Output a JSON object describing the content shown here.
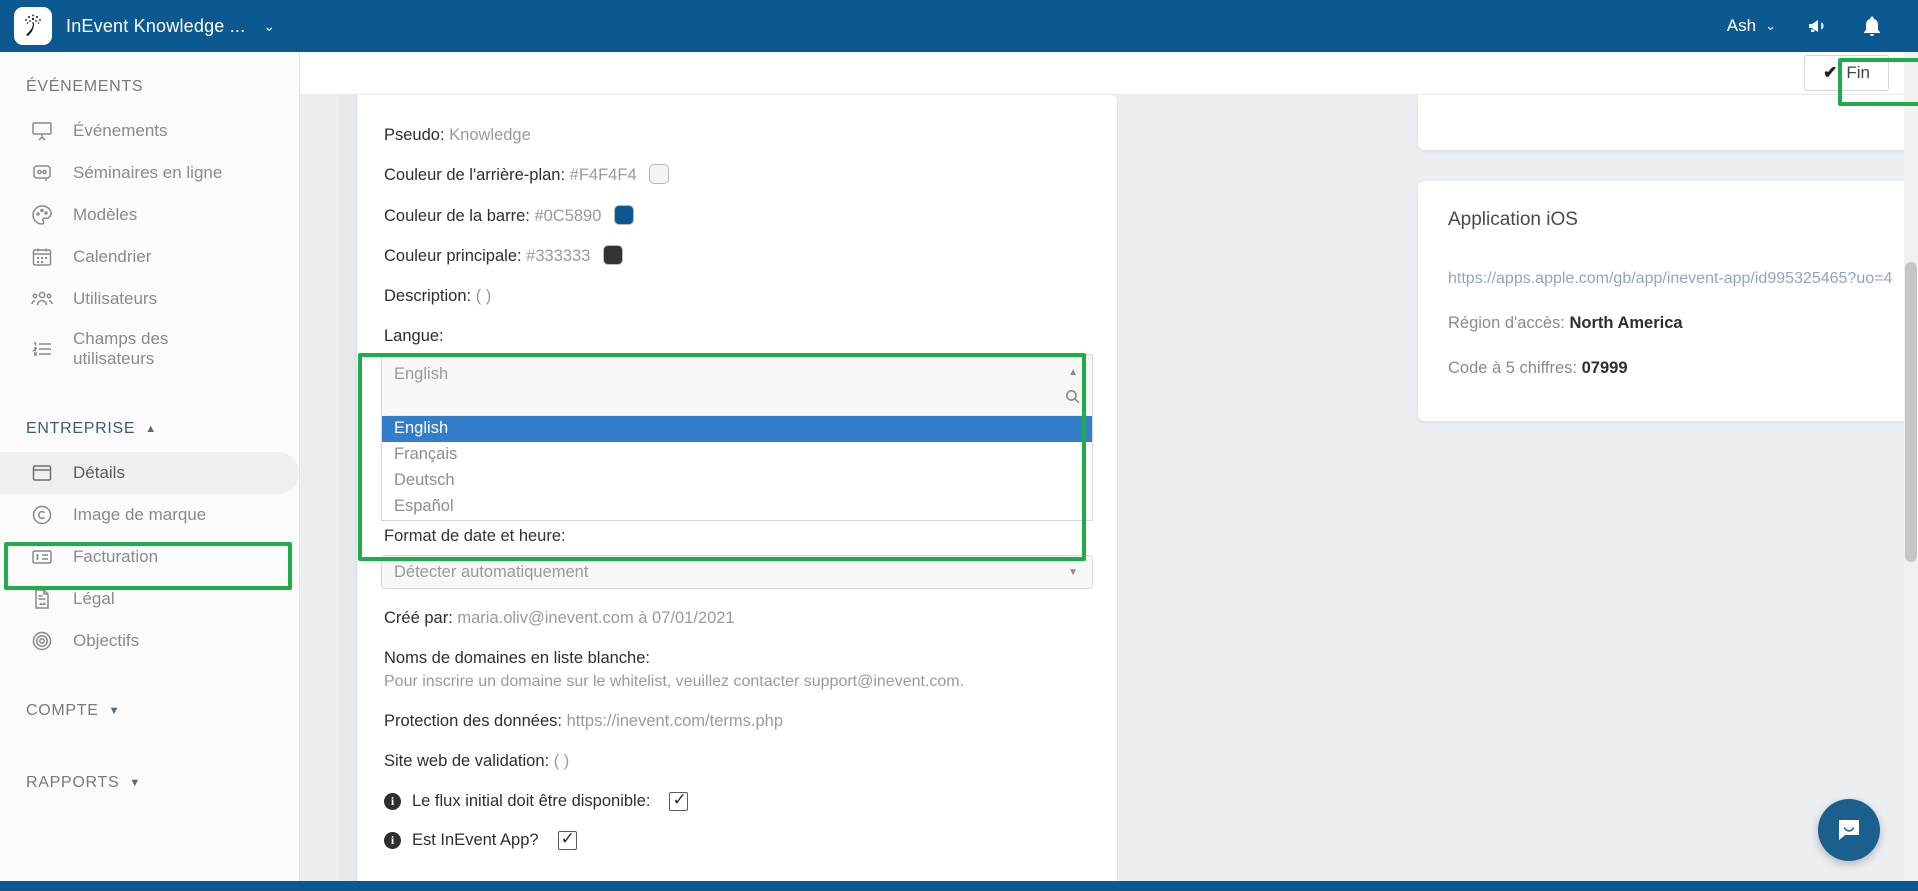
{
  "topbar": {
    "brand_title": "InEvent Knowledge ...",
    "brand_caret": "⌄",
    "user_name": "Ash",
    "user_caret": "⌄",
    "announcement_icon": "megaphone-icon",
    "notifications_icon": "bell-icon",
    "bar_color": "#0C5890"
  },
  "subheader": {
    "finish_label": "Fin",
    "finish_check": "✔"
  },
  "sidebar": {
    "events_section_title": "ÉVÉNEMENTS",
    "events_items": [
      {
        "label": "Événements",
        "icon": "presentation-screen-icon"
      },
      {
        "label": "Séminaires en ligne",
        "icon": "webinar-icon"
      },
      {
        "label": "Modèles",
        "icon": "palette-icon"
      },
      {
        "label": "Calendrier",
        "icon": "calendar-icon"
      },
      {
        "label": "Utilisateurs",
        "icon": "users-icon"
      },
      {
        "label": "Champs des utilisateurs",
        "icon": "list-numbered-icon"
      }
    ],
    "enterprise_section_title": "ENTREPRISE",
    "enterprise_chevron": "▲",
    "enterprise_items": [
      {
        "label": "Détails",
        "icon": "window-icon",
        "active": true
      },
      {
        "label": "Image de marque",
        "icon": "copyright-icon",
        "active": false
      },
      {
        "label": "Facturation",
        "icon": "billing-card-icon",
        "active": false
      },
      {
        "label": "Légal",
        "icon": "document-icon",
        "active": false
      },
      {
        "label": "Objectifs",
        "icon": "target-icon",
        "active": false
      }
    ],
    "account_section_title": "COMPTE",
    "account_chevron": "▼",
    "reports_section_title": "RAPPORTS",
    "reports_chevron": "▼"
  },
  "details_form": {
    "pseudo_label": "Pseudo:",
    "pseudo_value": "Knowledge",
    "bg_color_label": "Couleur de l'arrière-plan:",
    "bg_color_value": "#F4F4F4",
    "bg_color_hex": "#F4F4F4",
    "bar_color_label": "Couleur de la barre:",
    "bar_color_value": "#0C5890",
    "bar_color_hex": "#0C5890",
    "main_color_label": "Couleur principale:",
    "main_color_value": "#333333",
    "main_color_hex": "#333333",
    "description_label": "Description:",
    "description_value": "( )",
    "language_label": "Langue:",
    "language_selected": "English",
    "language_search_icon": "search-icon",
    "language_up_caret": "▲",
    "language_options": [
      {
        "label": "English",
        "selected": true
      },
      {
        "label": "Français",
        "selected": false
      },
      {
        "label": "Deutsch",
        "selected": false
      },
      {
        "label": "Español",
        "selected": false
      }
    ],
    "datetime_format_label": "Format de date et heure:",
    "datetime_format_value": "Détecter automatiquement",
    "datetime_caret": "▼",
    "created_by_label": "Créé par:",
    "created_by_value": "maria.oliv@inevent.com à 07/01/2021",
    "whitelist_label": "Noms de domaines en liste blanche:",
    "whitelist_note": "Pour inscrire un domaine sur le whitelist, veuillez contacter support@inevent.com.",
    "data_protection_label": "Protection des données:",
    "data_protection_value": "https://inevent.com/terms.php",
    "validation_site_label": "Site web de validation:",
    "validation_site_value": "( )",
    "initial_feed_label": "Le flux initial doit être disponible:",
    "initial_feed_checked": true,
    "is_inevent_app_label": "Est InEvent App?",
    "is_inevent_app_checked": true
  },
  "ios_card": {
    "title": "Application iOS",
    "store_url": "https://apps.apple.com/gb/app/inevent-app/id995325465?uo=4",
    "region_label": "Région d'accès:",
    "region_value": "North America",
    "code_label": "Code à 5 chiffres:",
    "code_value": "07999"
  },
  "widgets": {
    "chat_icon": "chat-bubble-icon"
  },
  "highlight_color": "#1FAD4B"
}
